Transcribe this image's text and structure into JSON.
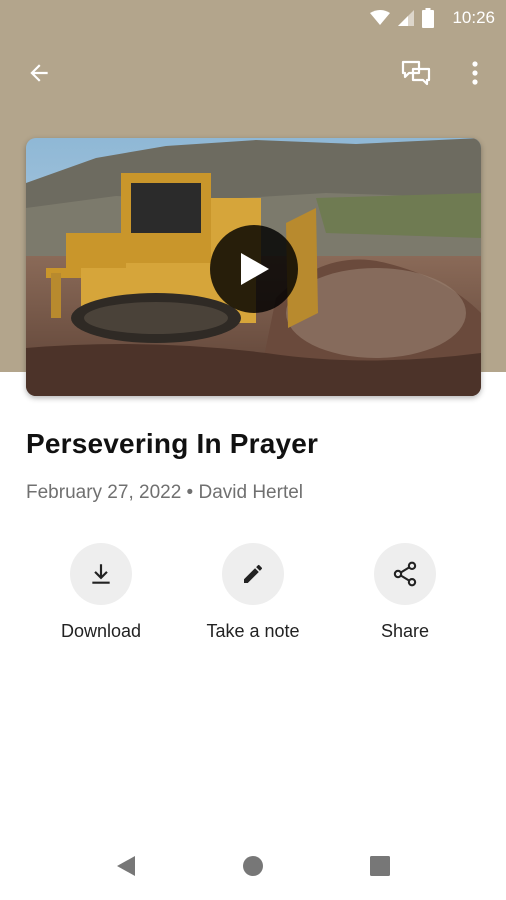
{
  "status_bar": {
    "time": "10:26"
  },
  "app_bar": {
    "back_icon": "arrow-back-icon",
    "chat_icon": "chat-icon",
    "more_icon": "more-vert-icon"
  },
  "video": {
    "play_icon": "play-icon"
  },
  "sermon": {
    "title": "Persevering In Prayer",
    "date": "February 27, 2022",
    "separator": " • ",
    "speaker": "David Hertel"
  },
  "actions": [
    {
      "label": "Download",
      "icon": "download-icon"
    },
    {
      "label": "Take a note",
      "icon": "pencil-icon"
    },
    {
      "label": "Share",
      "icon": "share-icon"
    }
  ],
  "colors": {
    "header_bg": "#b3a58c",
    "action_bg": "#eeeeee",
    "meta_text": "#707070"
  }
}
